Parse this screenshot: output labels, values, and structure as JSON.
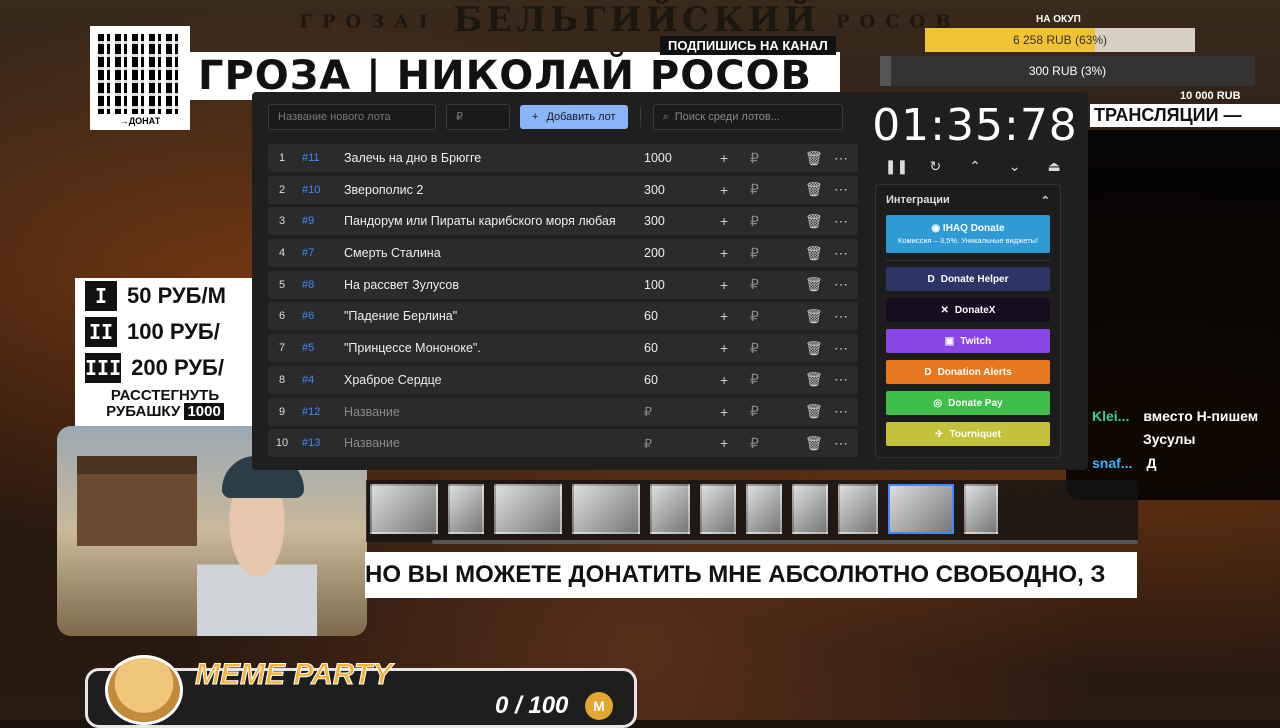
{
  "overlay": {
    "top_title_small": "ГРОЗАІ",
    "top_title_main": "БЕЛЬГИЙСКИЙ",
    "top_title_right": "РОСОВ",
    "banner_text": "ГРОЗА | НИКОЛАЙ РОСОВ",
    "subscribe_tag": "ПОДПИШИСЬ НА КАНАЛ",
    "qr_caption": "→ДОНАТ",
    "goal_label": "НА ОКУП",
    "goal1_text": "6 258 RUB (63%)",
    "goal1_fraction": 0.63,
    "goal2_text": "300 RUB (3%)",
    "goal2_fraction": 0.03,
    "goal2_max": "10 000 RUB",
    "stream_label": "ТРАНСЛЯЦИИ —",
    "rates": [
      {
        "bars": "I",
        "text": "50 РУБ/М"
      },
      {
        "bars": "II",
        "text": "100 РУБ/"
      },
      {
        "bars": "III",
        "text": "200 РУБ/"
      }
    ],
    "rates_cta_line1": "РАССТЕГНУТЬ",
    "rates_cta_line2": "РУБАШКУ",
    "rates_cta_amount": "1000",
    "meme_title": "MEME PARTY",
    "meme_count": "0 / 100",
    "meme_coin": "M",
    "ticker_text": "НО ВЫ МОЖЕТЕ ДОНАТИТЬ МНЕ АБСОЛЮТНО СВОБОДНО, З",
    "chat": [
      {
        "user": "Klei...",
        "msg": "вместо Н-пишем"
      },
      {
        "user": "",
        "msg": "Зусулы"
      },
      {
        "user": "snaf...",
        "msg": "Д"
      }
    ]
  },
  "app": {
    "new_lot_placeholder": "Название нового лота",
    "amount_placeholder": "₽",
    "add_button": "Добавить лот",
    "search_placeholder": "Поиск среди лотов...",
    "lots": [
      {
        "num": "1",
        "id": "#11",
        "name": "Залечь на дно в Брюгге",
        "amount": "1000",
        "placeholder": false
      },
      {
        "num": "2",
        "id": "#10",
        "name": "Зверополис 2",
        "amount": "300",
        "placeholder": false
      },
      {
        "num": "3",
        "id": "#9",
        "name": "Пандорум или Пираты карибского моря любая",
        "amount": "300",
        "placeholder": false
      },
      {
        "num": "4",
        "id": "#7",
        "name": "Смерть Сталина",
        "amount": "200",
        "placeholder": false
      },
      {
        "num": "5",
        "id": "#8",
        "name": "На рассвет Зулусов",
        "amount": "100",
        "placeholder": false
      },
      {
        "num": "6",
        "id": "#6",
        "name": "\"Падение Берлина\"",
        "amount": "60",
        "placeholder": false
      },
      {
        "num": "7",
        "id": "#5",
        "name": "\"Принцессе Мононоке\".",
        "amount": "60",
        "placeholder": false
      },
      {
        "num": "8",
        "id": "#4",
        "name": "Храброе Сердце",
        "amount": "60",
        "placeholder": false
      },
      {
        "num": "9",
        "id": "#12",
        "name": "Название",
        "amount": "₽",
        "placeholder": true
      },
      {
        "num": "10",
        "id": "#13",
        "name": "Название",
        "amount": "₽",
        "placeholder": true
      }
    ],
    "timer": "01:35:78",
    "integrations_title": "Интеграции",
    "integrations": [
      {
        "label": "IHAQ Donate",
        "sub": "Комиссия – 3,5%. Уникальные виджеты!",
        "color": "#2e9bd6",
        "icon": "◉",
        "main": true
      },
      {
        "label": "Donate Helper",
        "color": "#2d3566",
        "icon": "D",
        "main": false
      },
      {
        "label": "DonateX",
        "color": "#170d20",
        "icon": "✕",
        "main": false
      },
      {
        "label": "Twitch",
        "color": "#8b46e6",
        "icon": "▣",
        "main": false
      },
      {
        "label": "Donation Alerts",
        "color": "#e8781f",
        "icon": "D",
        "main": false
      },
      {
        "label": "Donate Pay",
        "color": "#3dbf4a",
        "icon": "◎",
        "main": false
      },
      {
        "label": "Tourniquet",
        "color": "#c4c23a",
        "icon": "✈",
        "main": false
      }
    ]
  }
}
